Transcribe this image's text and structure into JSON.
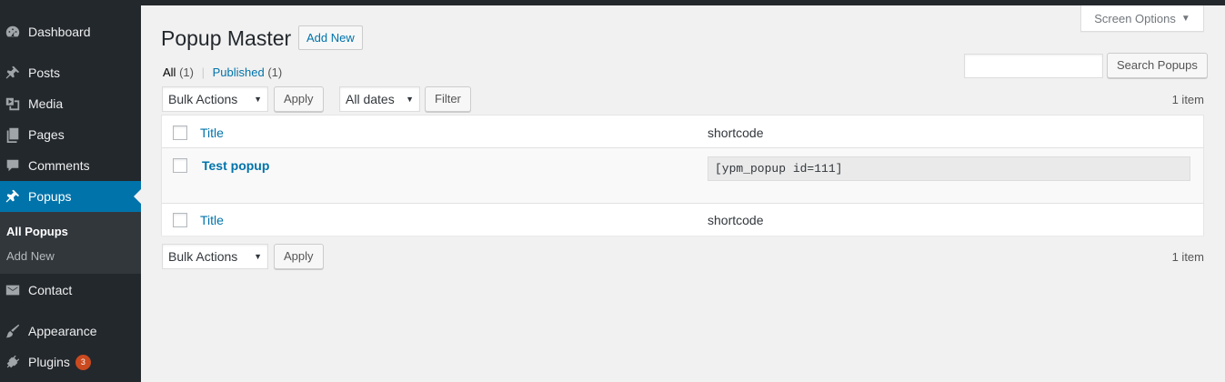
{
  "sidebar": {
    "items": [
      {
        "label": "Dashboard",
        "icon": "dashboard-icon"
      },
      {
        "label": "Posts",
        "icon": "pin-icon"
      },
      {
        "label": "Media",
        "icon": "media-icon"
      },
      {
        "label": "Pages",
        "icon": "pages-icon"
      },
      {
        "label": "Comments",
        "icon": "comment-icon"
      },
      {
        "label": "Popups",
        "icon": "pin-icon"
      },
      {
        "label": "Contact",
        "icon": "mail-icon"
      },
      {
        "label": "Appearance",
        "icon": "brush-icon"
      },
      {
        "label": "Plugins",
        "icon": "plugin-icon",
        "badge": "3"
      }
    ],
    "submenu": [
      {
        "label": "All Popups"
      },
      {
        "label": "Add New"
      }
    ]
  },
  "header": {
    "screen_options": "Screen Options",
    "title": "Popup Master",
    "add_new": "Add New"
  },
  "filters": {
    "all_label": "All",
    "all_count": "(1)",
    "published_label": "Published",
    "published_count": "(1)",
    "separator": "|"
  },
  "search": {
    "value": "",
    "button": "Search Popups"
  },
  "toolbar_top": {
    "bulk_actions": "Bulk Actions",
    "apply": "Apply",
    "dates": "All dates",
    "filter": "Filter",
    "count": "1 item"
  },
  "table": {
    "columns": [
      "Title",
      "shortcode"
    ],
    "rows": [
      {
        "title": "Test popup",
        "shortcode": "[ypm_popup id=111]"
      }
    ]
  },
  "toolbar_bottom": {
    "bulk_actions": "Bulk Actions",
    "apply": "Apply",
    "count": "1 item"
  },
  "colors": {
    "sidebar_bg": "#23282d",
    "accent": "#0073aa",
    "badge": "#ca4a1f"
  }
}
